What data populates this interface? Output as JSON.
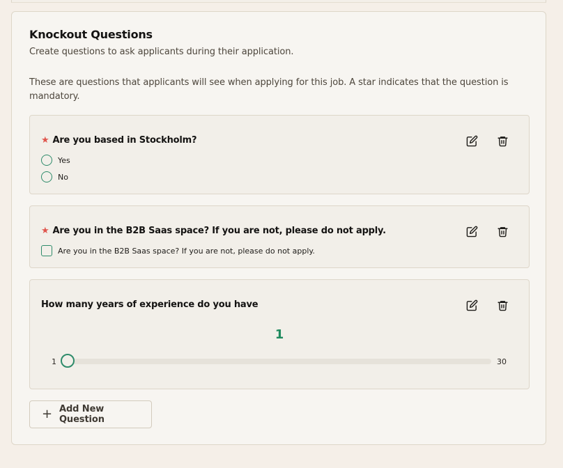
{
  "section": {
    "title": "Knockout Questions",
    "subtitle": "Create questions to ask applicants during their application.",
    "description": "These are questions that applicants will see when applying for this job. A star indicates that the question is mandatory."
  },
  "questions": [
    {
      "title": "Are you based in Stockholm?",
      "mandatory": true,
      "type": "radio",
      "options": [
        "Yes",
        "No"
      ]
    },
    {
      "title": "Are you in the B2B Saas space? If you are not, please do not apply.",
      "mandatory": true,
      "type": "checkbox",
      "options": [
        "Are you in the B2B Saas space? If you are not, please do not apply."
      ]
    },
    {
      "title": "How many years of experience do you have",
      "mandatory": false,
      "type": "slider",
      "value": "1",
      "min": "1",
      "max": "30"
    }
  ],
  "icons": {
    "star": "★",
    "edit": "edit-icon",
    "delete": "trash-icon",
    "add": "+"
  },
  "add_button_label": "Add New Question",
  "colors": {
    "accent": "#2e8b6a",
    "star": "#e0554d",
    "value": "#1f8a5e"
  }
}
